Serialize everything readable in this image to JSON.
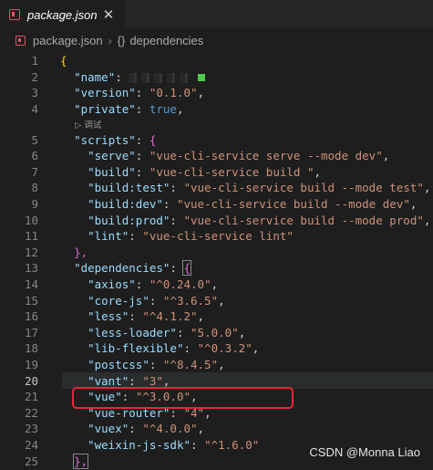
{
  "tab": {
    "label": "package.json",
    "close": "✕"
  },
  "breadcrumb": {
    "file": "package.json",
    "separator": "›",
    "braces": "{}",
    "node": "dependencies"
  },
  "codelens": "▷ 调试",
  "lines": [
    {
      "num": "1"
    },
    {
      "num": "2"
    },
    {
      "num": "3"
    },
    {
      "num": "4"
    },
    {
      "num": "5"
    },
    {
      "num": "6"
    },
    {
      "num": "7"
    },
    {
      "num": "8"
    },
    {
      "num": "9"
    },
    {
      "num": "10"
    },
    {
      "num": "11"
    },
    {
      "num": "12"
    },
    {
      "num": "13"
    },
    {
      "num": "14"
    },
    {
      "num": "15"
    },
    {
      "num": "16"
    },
    {
      "num": "17"
    },
    {
      "num": "18"
    },
    {
      "num": "19"
    },
    {
      "num": "20"
    },
    {
      "num": "21"
    },
    {
      "num": "22"
    },
    {
      "num": "23"
    },
    {
      "num": "24"
    },
    {
      "num": "25"
    }
  ],
  "code": {
    "l1": "{",
    "name_key": "\"name\"",
    "colon": ": ",
    "comma": ",",
    "version_key": "\"version\"",
    "version_val": "\"0.1.0\"",
    "private_key": "\"private\"",
    "private_val": "true",
    "scripts_key": "\"scripts\"",
    "open_brace": "{",
    "close_brace": "}",
    "scripts": [
      {
        "key": "\"serve\"",
        "val": "\"vue-cli-service serve --mode dev\"",
        "comma": ","
      },
      {
        "key": "\"build\"",
        "val": "\"vue-cli-service build \"",
        "comma": ","
      },
      {
        "key": "\"build:test\"",
        "val": "\"vue-cli-service build --mode test\"",
        "comma": ","
      },
      {
        "key": "\"build:dev\"",
        "val": "\"vue-cli-service build --mode dev\"",
        "comma": ","
      },
      {
        "key": "\"build:prod\"",
        "val": "\"vue-cli-service build --mode prod\"",
        "comma": ","
      },
      {
        "key": "\"lint\"",
        "val": "\"vue-cli-service lint\"",
        "comma": ""
      }
    ],
    "scripts_close": "},",
    "deps_key": "\"dependencies\"",
    "deps": [
      {
        "key": "\"axios\"",
        "val": "\"^0.24.0\"",
        "comma": ","
      },
      {
        "key": "\"core-js\"",
        "val": "\"^3.6.5\"",
        "comma": ","
      },
      {
        "key": "\"less\"",
        "val": "\"^4.1.2\"",
        "comma": ","
      },
      {
        "key": "\"less-loader\"",
        "val": "\"5.0.0\"",
        "comma": ","
      },
      {
        "key": "\"lib-flexible\"",
        "val": "\"^0.3.2\"",
        "comma": ","
      },
      {
        "key": "\"postcss\"",
        "val": "\"^8.4.5\"",
        "comma": ","
      },
      {
        "key": "\"vant\"",
        "val": "\"3\"",
        "comma": ","
      },
      {
        "key": "\"vue\"",
        "val": "\"^3.0.0\"",
        "comma": ","
      },
      {
        "key": "\"vue-router\"",
        "val": "\"4\"",
        "comma": ","
      },
      {
        "key": "\"vuex\"",
        "val": "\"^4.0.0\"",
        "comma": ","
      },
      {
        "key": "\"weixin-js-sdk\"",
        "val": "\"^1.6.0\"",
        "comma": ""
      }
    ],
    "deps_close": "},"
  },
  "watermark": "CSDN @Monna Liao",
  "colors": {
    "key": "#9cdcfe",
    "string": "#ce9178",
    "keyword": "#569cd6",
    "annotation": "#e8253b"
  }
}
